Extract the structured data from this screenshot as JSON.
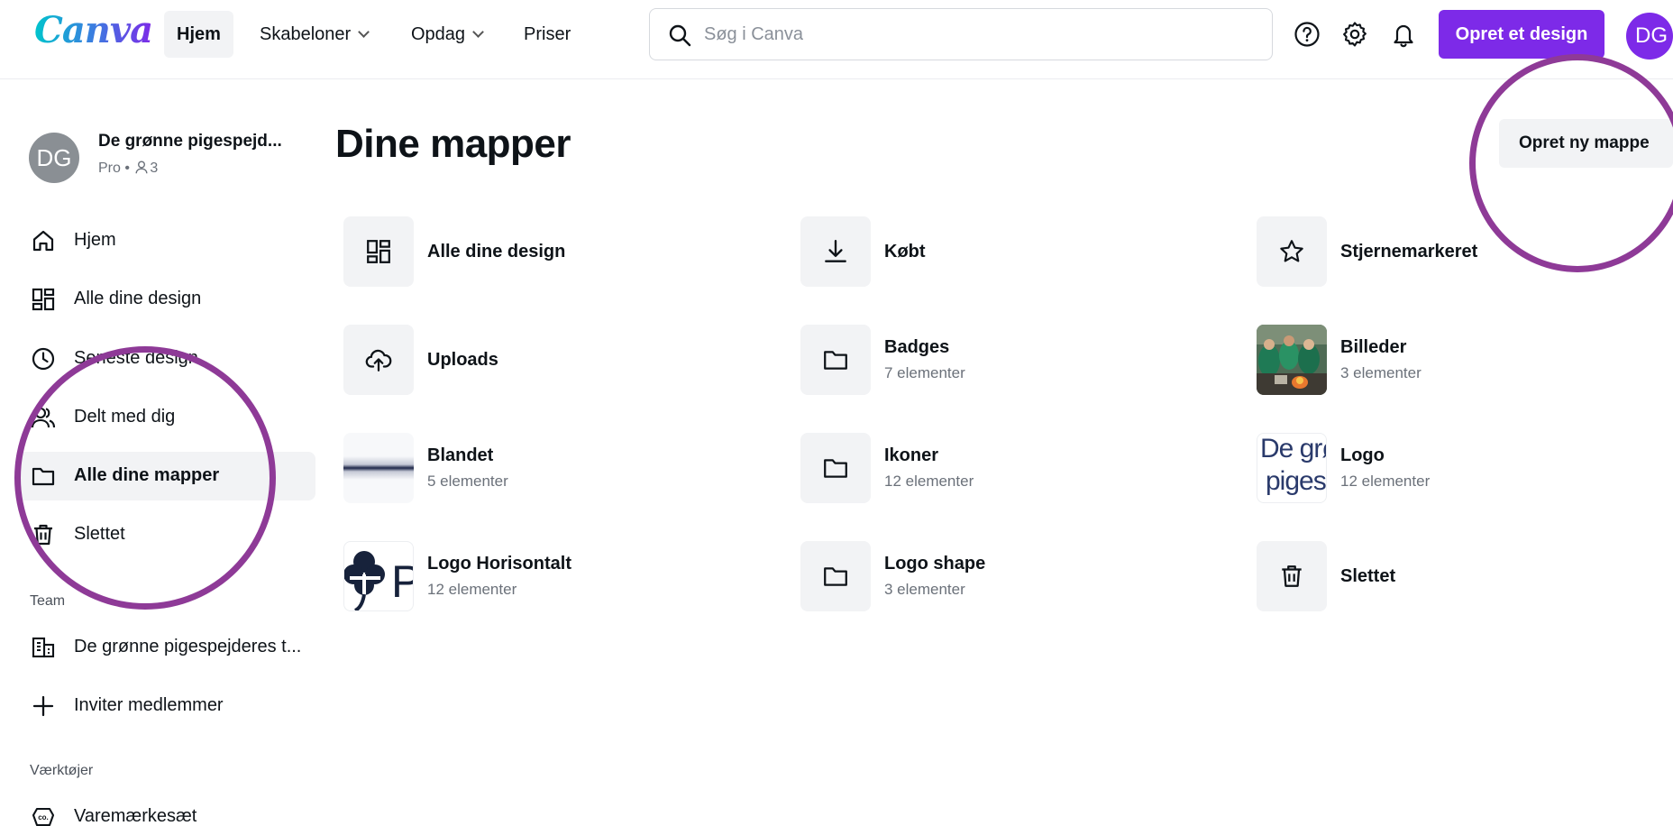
{
  "header": {
    "logo": "Canva",
    "nav": [
      {
        "label": "Hjem",
        "active": true,
        "dropdown": false
      },
      {
        "label": "Skabeloner",
        "active": false,
        "dropdown": true
      },
      {
        "label": "Opdag",
        "active": false,
        "dropdown": true
      },
      {
        "label": "Priser",
        "active": false,
        "dropdown": false
      }
    ],
    "search_placeholder": "Søg i Canva",
    "icons": [
      "help-icon",
      "gear-icon",
      "bell-icon"
    ],
    "create_label": "Opret et design",
    "avatar_initials": "DG"
  },
  "sidebar": {
    "account": {
      "initials": "DG",
      "name": "De grønne pigespejd...",
      "plan": "Pro",
      "members": "3"
    },
    "items": [
      {
        "label": "Hjem",
        "icon": "home-icon"
      },
      {
        "label": "Alle dine design",
        "icon": "grid-icon"
      },
      {
        "label": "Seneste design",
        "icon": "clock-icon"
      },
      {
        "label": "Delt med dig",
        "icon": "people-icon"
      },
      {
        "label": "Alle dine mapper",
        "icon": "folder-icon",
        "active": true
      },
      {
        "label": "Slettet",
        "icon": "trash-icon"
      }
    ],
    "team_label": "Team",
    "team_items": [
      {
        "label": "De grønne pigespejderes t...",
        "icon": "building-icon"
      },
      {
        "label": "Inviter medlemmer",
        "icon": "plus-icon"
      }
    ],
    "tools_label": "Værktøjer",
    "tools_items": [
      {
        "label": "Varemærkesæt",
        "icon": "brand-kit-icon"
      }
    ]
  },
  "main": {
    "title": "Dine mapper",
    "new_folder_label": "Opret ny mappe",
    "folders": [
      {
        "name": "Alle dine design",
        "count": "",
        "icon": "grid-icon"
      },
      {
        "name": "Købt",
        "count": "",
        "icon": "download-icon"
      },
      {
        "name": "Stjernemarkeret",
        "count": "",
        "icon": "star-icon"
      },
      {
        "name": "Uploads",
        "count": "",
        "icon": "cloud-upload-icon"
      },
      {
        "name": "Badges",
        "count": "7 elementer",
        "icon": "folder-icon"
      },
      {
        "name": "Billeder",
        "count": "3 elementer",
        "icon": "photo-thumbnail"
      },
      {
        "name": "Blandet",
        "count": "5 elementer",
        "icon": "stripe-thumbnail"
      },
      {
        "name": "Ikoner",
        "count": "12 elementer",
        "icon": "folder-icon"
      },
      {
        "name": "Logo",
        "count": "12 elementer",
        "icon": "logo-text-thumbnail"
      },
      {
        "name": "Logo Horisontalt",
        "count": "12 elementer",
        "icon": "clover-thumbnail"
      },
      {
        "name": "Logo shape",
        "count": "3 elementer",
        "icon": "folder-icon"
      },
      {
        "name": "Slettet",
        "count": "",
        "icon": "trash-icon"
      }
    ],
    "thumb_texts": {
      "logo_line1": "De grøı",
      "logo_line2": "pigesp",
      "clover_letter": "P"
    }
  },
  "colors": {
    "accent": "#7d2ae8",
    "annotation": "#8e3a97",
    "tile_bg": "#f2f3f5"
  }
}
